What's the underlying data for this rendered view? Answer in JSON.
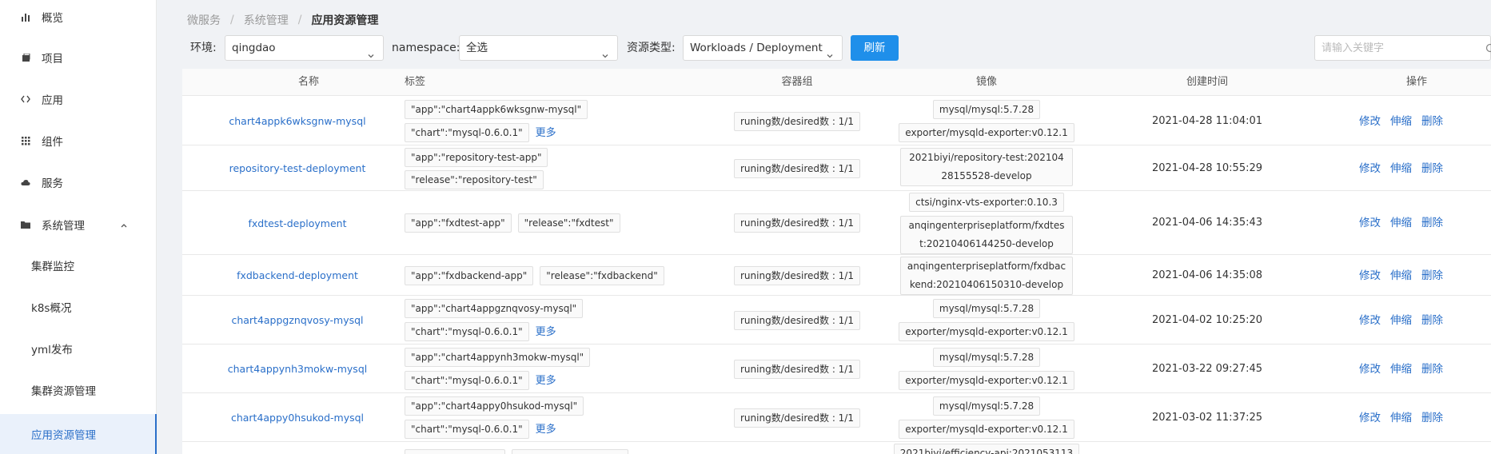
{
  "sidebar": {
    "items": [
      {
        "label": "概览",
        "icon": "bar-chart-icon"
      },
      {
        "label": "项目",
        "icon": "project-icon"
      },
      {
        "label": "应用",
        "icon": "code-icon"
      },
      {
        "label": "组件",
        "icon": "grid-icon"
      },
      {
        "label": "服务",
        "icon": "cloud-icon"
      },
      {
        "label": "系统管理",
        "icon": "folder-icon"
      }
    ],
    "sub_items": [
      {
        "label": "集群监控"
      },
      {
        "label": "k8s概况"
      },
      {
        "label": "yml发布"
      },
      {
        "label": "集群资源管理"
      },
      {
        "label": "应用资源管理"
      }
    ]
  },
  "breadcrumb": {
    "items": [
      "微服务",
      "系统管理",
      "应用资源管理"
    ]
  },
  "filters": {
    "env_label": "环境:",
    "env_value": "qingdao",
    "ns_label": "namespace:",
    "ns_value": "全选",
    "type_label": "资源类型:",
    "type_value": "Workloads / Deployment",
    "refresh": "刷新",
    "search_placeholder": "请输入关键字"
  },
  "table": {
    "headers": {
      "name": "名称",
      "tags": "标签",
      "pods": "容器组",
      "image": "镜像",
      "created": "创建时间",
      "ops": "操作"
    },
    "ops": {
      "edit": "修改",
      "scale": "伸缩",
      "delete": "删除"
    },
    "more": "更多",
    "rows": [
      {
        "name": "chart4appk6wksgnw-mysql",
        "tags": [
          "\"app\":\"chart4appk6wksgnw-mysql\"",
          "\"chart\":\"mysql-0.6.0.1\""
        ],
        "pods": "runing数/desired数 : 1/1",
        "images": [
          "mysql/mysql:5.7.28",
          "exporter/mysqld-exporter:v0.12.1"
        ],
        "created": "2021-04-28 11:04:01"
      },
      {
        "name": "repository-test-deployment",
        "tags": [
          "\"app\":\"repository-test-app\"",
          "\"release\":\"repository-test\""
        ],
        "pods": "runing数/desired数 : 1/1",
        "images": [
          "2021biyi/repository-test:20210428155528-develop"
        ],
        "created": "2021-04-28 10:55:29"
      },
      {
        "name": "fxdtest-deployment",
        "tags": [
          "\"app\":\"fxdtest-app\"",
          "\"release\":\"fxdtest\""
        ],
        "pods": "runing数/desired数 : 1/1",
        "images": [
          "ctsi/nginx-vts-exporter:0.10.3",
          "anqingenterpriseplatform/fxdtest:20210406144250-develop"
        ],
        "created": "2021-04-06 14:35:43"
      },
      {
        "name": "fxdbackend-deployment",
        "tags": [
          "\"app\":\"fxdbackend-app\"",
          "\"release\":\"fxdbackend\""
        ],
        "pods": "runing数/desired数 : 1/1",
        "images": [
          "anqingenterpriseplatform/fxdbackend:20210406150310-develop"
        ],
        "created": "2021-04-06 14:35:08"
      },
      {
        "name": "chart4appgznqvosy-mysql",
        "tags": [
          "\"app\":\"chart4appgznqvosy-mysql\"",
          "\"chart\":\"mysql-0.6.0.1\""
        ],
        "pods": "runing数/desired数 : 1/1",
        "images": [
          "mysql/mysql:5.7.28",
          "exporter/mysqld-exporter:v0.12.1"
        ],
        "created": "2021-04-02 10:25:20"
      },
      {
        "name": "chart4appynh3mokw-mysql",
        "tags": [
          "\"app\":\"chart4appynh3mokw-mysql\"",
          "\"chart\":\"mysql-0.6.0.1\""
        ],
        "pods": "runing数/desired数 : 1/1",
        "images": [
          "mysql/mysql:5.7.28",
          "exporter/mysqld-exporter:v0.12.1"
        ],
        "created": "2021-03-22 09:27:45"
      },
      {
        "name": "chart4appy0hsukod-mysql",
        "tags": [
          "\"app\":\"chart4appy0hsukod-mysql\"",
          "\"chart\":\"mysql-0.6.0.1\""
        ],
        "pods": "runing数/desired数 : 1/1",
        "images": [
          "mysql/mysql:5.7.28",
          "exporter/mysqld-exporter:v0.12.1"
        ],
        "created": "2021-03-02 11:37:25"
      }
    ],
    "partial_row": {
      "image": "2021biyi/efficiency-api:2021053113"
    }
  }
}
